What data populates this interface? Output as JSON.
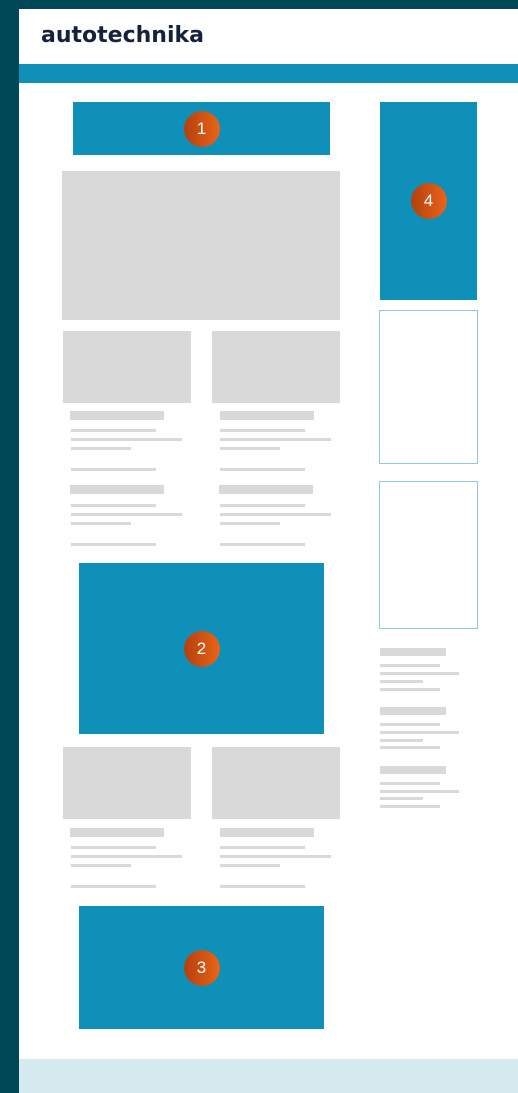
{
  "header": {
    "logo_text": "autotechnika"
  },
  "ad_slots": [
    {
      "number": "1"
    },
    {
      "number": "2"
    },
    {
      "number": "3"
    },
    {
      "number": "4"
    }
  ],
  "colors": {
    "frame": "#004857",
    "ad_blue": "#0f90b8",
    "placeholder_gray": "#d9d9d9",
    "badge_orange": "#e8651a",
    "footer": "#d5ebef"
  }
}
